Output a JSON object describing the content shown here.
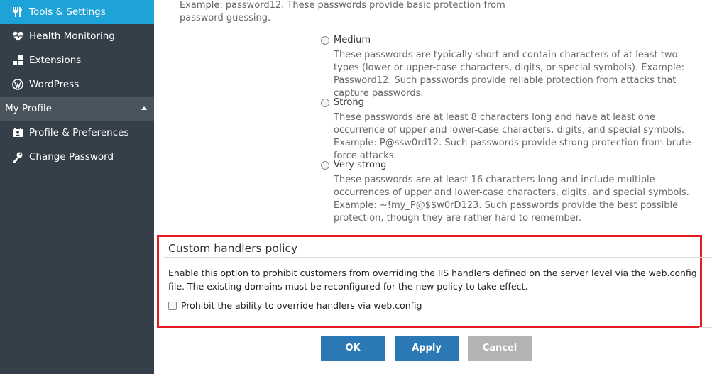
{
  "sidebar": {
    "items": [
      {
        "label": "Tools & Settings",
        "icon": "tools-icon",
        "active": true
      },
      {
        "label": "Health Monitoring",
        "icon": "heartbeat-icon"
      },
      {
        "label": "Extensions",
        "icon": "extensions-icon"
      },
      {
        "label": "WordPress",
        "icon": "wordpress-icon"
      }
    ],
    "section": {
      "label": "My Profile",
      "expanded": true
    },
    "profile_items": [
      {
        "label": "Profile & Preferences",
        "icon": "profile-card-icon"
      },
      {
        "label": "Change Password",
        "icon": "key-icon"
      }
    ],
    "colors": {
      "background": "#353f49",
      "active": "#1ea3d9",
      "section": "#4a545d"
    }
  },
  "password_strength": {
    "weak_desc_tail": "Example: password12. These passwords provide basic protection from password guessing.",
    "options": [
      {
        "label": "Medium",
        "description": "These passwords are typically short and contain characters of at least two types (lower or upper-case characters, digits, or special symbols). Example: Password12. Such passwords provide reliable protection from attacks that capture passwords."
      },
      {
        "label": "Strong",
        "description": "These passwords are at least 8 characters long and have at least one occurrence of upper and lower-case characters, digits, and special symbols. Example: P@ssw0rd12. Such passwords provide strong protection from brute-force attacks."
      },
      {
        "label": "Very strong",
        "description": "These passwords are at least 16 characters long and include multiple occurrences of upper and lower-case characters, digits, and special symbols. Example: ~!my_P@$$w0rD123. Such passwords provide the best possible protection, though they are rather hard to remember."
      }
    ]
  },
  "custom_handlers": {
    "title": "Custom handlers policy",
    "description": "Enable this option to prohibit customers from overriding the IIS handlers defined on the server level via the web.config file. The existing domains must be reconfigured for the new policy to take effect.",
    "checkbox_label": "Prohibit the ability to override handlers via web.config",
    "checked": false,
    "highlight_color": "#e31b23"
  },
  "buttons": {
    "ok": "OK",
    "apply": "Apply",
    "cancel": "Cancel"
  }
}
